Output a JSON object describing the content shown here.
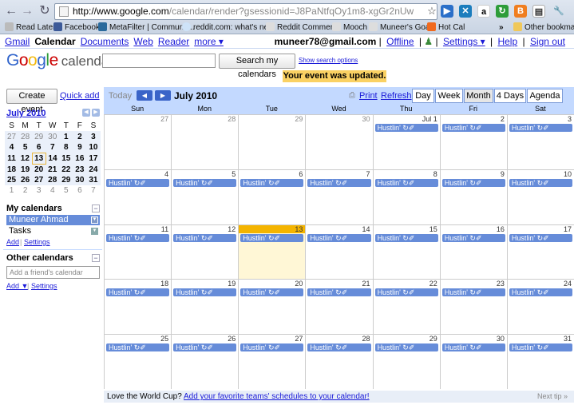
{
  "browser": {
    "url_host": "http://www.google.com",
    "url_path": "/calendar/render?gsessionid=J8PaNtfqOy1m8-xgGr2nUw",
    "bookmarks": [
      "Read Later",
      "Facebook",
      "MetaFilter | Communit...",
      "reddit.com: what's ne...",
      "Reddit Comments",
      "Mooch",
      "Muneer's Goals",
      "Hot Cal"
    ],
    "bookmark_overflow": "»",
    "other_bookmarks": "Other bookmarks"
  },
  "gbar": {
    "links": [
      "Gmail",
      "Calendar",
      "Documents",
      "Web",
      "Reader",
      "more ▾"
    ],
    "email": "muneer78@gmail.com",
    "offline": "Offline",
    "settings": "Settings ▾",
    "help": "Help",
    "signout": "Sign out"
  },
  "header": {
    "logo_word": "Google",
    "logo_sub": "calendar",
    "search_button": "Search my calendars",
    "search_options": "Show search options",
    "notice": "Your event was updated."
  },
  "left": {
    "create_event": "Create event",
    "quick_add": "Quick add",
    "mini_title": "July 2010",
    "mini_prev": "◀",
    "mini_next": "▶",
    "mini_dow": [
      "S",
      "M",
      "T",
      "W",
      "T",
      "F",
      "S"
    ],
    "mini_weeks": [
      [
        "27",
        "28",
        "29",
        "30",
        "1",
        "2",
        "3"
      ],
      [
        "4",
        "5",
        "6",
        "7",
        "8",
        "9",
        "10"
      ],
      [
        "11",
        "12",
        "13",
        "14",
        "15",
        "16",
        "17"
      ],
      [
        "18",
        "19",
        "20",
        "21",
        "22",
        "23",
        "24"
      ],
      [
        "25",
        "26",
        "27",
        "28",
        "29",
        "30",
        "31"
      ],
      [
        "1",
        "2",
        "3",
        "4",
        "5",
        "6",
        "7"
      ]
    ],
    "my_calendars": "My calendars",
    "calendars": [
      "Muneer Ahmad",
      "Tasks"
    ],
    "add": "Add",
    "settings": "Settings",
    "other_calendars": "Other calendars",
    "friend_placeholder": "Add a friend's calendar",
    "add2": "Add ▼",
    "settings2": "Settings"
  },
  "toolbar": {
    "today": "Today",
    "prev": "◀",
    "next": "▶",
    "month_title": "July 2010",
    "print": "Print",
    "refresh": "Refresh",
    "views": [
      "Day",
      "Week",
      "Month",
      "4 Days",
      "Agenda"
    ],
    "active_view": "Month"
  },
  "calendar": {
    "days_of_week": [
      "Sun",
      "Mon",
      "Tue",
      "Wed",
      "Thu",
      "Fri",
      "Sat"
    ],
    "weeks": [
      [
        "27",
        "28",
        "29",
        "30",
        "Jul 1",
        "2",
        "3"
      ],
      [
        "4",
        "5",
        "6",
        "7",
        "8",
        "9",
        "10"
      ],
      [
        "11",
        "12",
        "13",
        "14",
        "15",
        "16",
        "17"
      ],
      [
        "18",
        "19",
        "20",
        "21",
        "22",
        "23",
        "24"
      ],
      [
        "25",
        "26",
        "27",
        "28",
        "29",
        "30",
        "31"
      ]
    ],
    "today_label": "13",
    "event_label": "Hustlin' ↻✐",
    "event_color": "#668cd9"
  },
  "footer": {
    "lead": "Love the World Cup?",
    "link": "Add your favorite teams' schedules to your calendar!",
    "next_tip": "Next tip »"
  }
}
